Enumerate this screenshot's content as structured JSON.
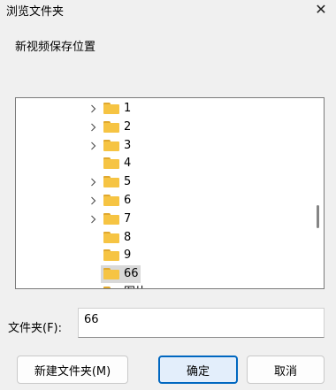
{
  "window": {
    "title": "浏览文件夹",
    "close_glyph": "✕"
  },
  "description": "新视频保存位置",
  "tree": {
    "items": [
      {
        "label": "1",
        "expandable": true
      },
      {
        "label": "2",
        "expandable": true
      },
      {
        "label": "3",
        "expandable": true
      },
      {
        "label": "4",
        "expandable": false
      },
      {
        "label": "5",
        "expandable": true
      },
      {
        "label": "6",
        "expandable": true
      },
      {
        "label": "7",
        "expandable": true
      },
      {
        "label": "8",
        "expandable": false
      },
      {
        "label": "9",
        "expandable": false
      },
      {
        "label": "66",
        "expandable": false,
        "selected": true
      },
      {
        "label": "图片",
        "expandable": false
      }
    ]
  },
  "folder_field": {
    "label": "文件夹(F):",
    "value": "66"
  },
  "buttons": {
    "new_folder": "新建文件夹(M)",
    "ok": "确定",
    "cancel": "取消"
  },
  "colors": {
    "folder": "#f6c443",
    "accent": "#0067c0",
    "selection": "#d9d9d9"
  }
}
